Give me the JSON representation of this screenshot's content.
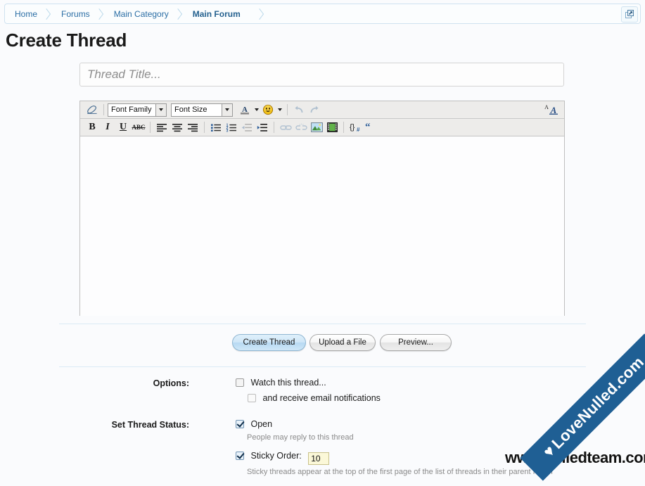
{
  "breadcrumb": {
    "items": [
      {
        "label": "Home",
        "current": false
      },
      {
        "label": "Forums",
        "current": false
      },
      {
        "label": "Main Category",
        "current": false
      },
      {
        "label": "Main Forum",
        "current": true
      }
    ],
    "popup_icon": "open-in-new-window-icon"
  },
  "page": {
    "title": "Create Thread"
  },
  "thread_title": {
    "value": "",
    "placeholder": "Thread Title..."
  },
  "editor": {
    "toolbar_row1": [
      {
        "name": "remove-formatting",
        "glyph": "eraser",
        "disabled": false
      },
      {
        "name": "font-family-select",
        "label": "Font Family"
      },
      {
        "name": "font-size-select",
        "label": "Font Size"
      },
      {
        "name": "font-color",
        "glyph": "A",
        "disabled": false
      },
      {
        "name": "smilies",
        "glyph": "smiley",
        "disabled": false
      },
      {
        "name": "undo",
        "glyph": "undo-arrow",
        "disabled": true
      },
      {
        "name": "redo",
        "glyph": "redo-arrow",
        "disabled": true
      }
    ],
    "toolbar_row2": [
      {
        "name": "bold",
        "glyph": "B",
        "disabled": false
      },
      {
        "name": "italic",
        "glyph": "I",
        "disabled": false
      },
      {
        "name": "underline",
        "glyph": "U",
        "disabled": false
      },
      {
        "name": "strikethrough",
        "glyph": "ABC",
        "disabled": false
      },
      {
        "name": "align-left",
        "glyph": "lines-left",
        "disabled": false
      },
      {
        "name": "align-center",
        "glyph": "lines-center",
        "disabled": false
      },
      {
        "name": "align-right",
        "glyph": "lines-right",
        "disabled": false
      },
      {
        "name": "bullet-list",
        "glyph": "bullets",
        "disabled": false
      },
      {
        "name": "numbered-list",
        "glyph": "numbers",
        "disabled": false
      },
      {
        "name": "outdent",
        "glyph": "outdent",
        "disabled": true
      },
      {
        "name": "indent",
        "glyph": "indent",
        "disabled": false
      },
      {
        "name": "insert-link",
        "glyph": "chain",
        "disabled": true
      },
      {
        "name": "remove-link",
        "glyph": "broken-chain",
        "disabled": true
      },
      {
        "name": "insert-image",
        "glyph": "picture",
        "disabled": false
      },
      {
        "name": "insert-media",
        "glyph": "film",
        "disabled": false
      },
      {
        "name": "insert-code",
        "glyph": "{}",
        "disabled": false
      },
      {
        "name": "insert-quote",
        "glyph": "quote",
        "disabled": false
      }
    ],
    "toggle_editor_icon": "toggle-bbcode-editor-icon",
    "content": ""
  },
  "actions": {
    "create": "Create Thread",
    "upload": "Upload a File",
    "preview": "Preview..."
  },
  "form": {
    "options_label": "Options:",
    "watch_thread": {
      "label": "Watch this thread...",
      "checked": false
    },
    "email_notifications": {
      "label": "and receive email notifications",
      "checked": false
    },
    "status_label": "Set Thread Status:",
    "open": {
      "label": "Open",
      "checked": true,
      "hint": "People may reply to this thread"
    },
    "sticky": {
      "label": "Sticky Order:",
      "checked": true,
      "value": "10",
      "hint": "Sticky threads appear at the top of the first page of the list of threads in their parent forum"
    }
  },
  "watermarks": {
    "ribbon_text": "LoveNulled.com",
    "ribbon_heart": "♥",
    "bottom_text": "www.nulledteam.com"
  },
  "colors": {
    "accent_blue": "#2b6ea5",
    "ribbon_blue": "#1f5f94",
    "heart_red": "#e02020",
    "sticky_field": "#fbf8d8"
  }
}
